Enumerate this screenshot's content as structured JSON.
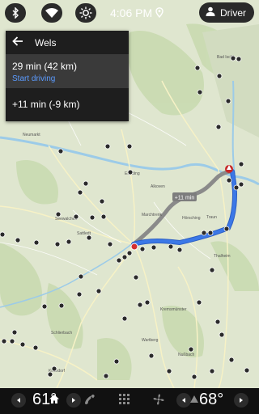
{
  "status": {
    "time": "4:06 PM",
    "profile_label": "Driver",
    "icons": [
      "bluetooth-icon",
      "wifi-icon",
      "brightness-icon",
      "location-icon",
      "person-icon"
    ]
  },
  "route_panel": {
    "destination": "Wels",
    "primary_route": "29 min (42 km)",
    "start_label": "Start driving",
    "alternate_route": "+11 min (-9 km)"
  },
  "map": {
    "alt_route_label": "+11 min",
    "place_labels": [
      "Bad Ischl",
      "Neumarkt",
      "Seewalchen",
      "Eferding",
      "Alkoven",
      "Marchtrenk",
      "Traun",
      "Thalheim",
      "Sattledt",
      "Kremsmünster",
      "Hörsching",
      "Wartberg",
      "Schlierbach",
      "Nußbach",
      "Kirchdorf"
    ],
    "colors": {
      "route_primary": "#3b78e7",
      "route_alternate": "#8a8a8a",
      "origin_pin": "#d32f2f",
      "land": "#dfe6cf",
      "water": "#9ccbe8"
    }
  },
  "navbar": {
    "driver_temp": "61°",
    "passenger_temp": "68°",
    "icons": [
      "left-temp-down-icon",
      "home-icon",
      "left-temp-up-icon",
      "phone-icon",
      "apps-grid-icon",
      "fan-icon",
      "right-temp-down-icon",
      "notification-icon",
      "right-temp-up-icon"
    ]
  }
}
